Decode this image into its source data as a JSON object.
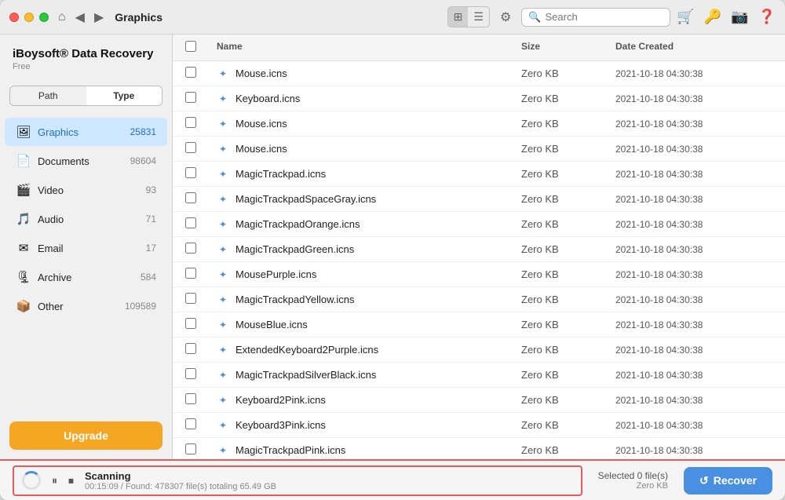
{
  "app": {
    "name": "iBoysoft® Data Recovery",
    "plan": "Free"
  },
  "titlebar": {
    "current_folder": "Graphics",
    "search_placeholder": "Search",
    "back_icon": "◀",
    "forward_icon": "▶",
    "home_icon": "⌂"
  },
  "sidebar": {
    "tabs": [
      "Path",
      "Type"
    ],
    "active_tab": "Type",
    "items": [
      {
        "id": "graphics",
        "label": "Graphics",
        "count": "25831",
        "icon": "🖼"
      },
      {
        "id": "documents",
        "label": "Documents",
        "count": "98604",
        "icon": "📄"
      },
      {
        "id": "video",
        "label": "Video",
        "count": "93",
        "icon": "🎬"
      },
      {
        "id": "audio",
        "label": "Audio",
        "count": "71",
        "icon": "🎵"
      },
      {
        "id": "email",
        "label": "Email",
        "count": "17",
        "icon": "✉"
      },
      {
        "id": "archive",
        "label": "Archive",
        "count": "584",
        "icon": "🗜"
      },
      {
        "id": "other",
        "label": "Other",
        "count": "109589",
        "icon": "📦"
      }
    ],
    "active_item": "graphics",
    "upgrade_label": "Upgrade"
  },
  "file_table": {
    "columns": [
      "",
      "Name",
      "Size",
      "Date Created"
    ],
    "files": [
      {
        "name": "Mouse.icns",
        "size": "Zero KB",
        "date": "2021-10-18 04:30:38"
      },
      {
        "name": "Keyboard.icns",
        "size": "Zero KB",
        "date": "2021-10-18 04:30:38"
      },
      {
        "name": "Mouse.icns",
        "size": "Zero KB",
        "date": "2021-10-18 04:30:38"
      },
      {
        "name": "Mouse.icns",
        "size": "Zero KB",
        "date": "2021-10-18 04:30:38"
      },
      {
        "name": "MagicTrackpad.icns",
        "size": "Zero KB",
        "date": "2021-10-18 04:30:38"
      },
      {
        "name": "MagicTrackpadSpaceGray.icns",
        "size": "Zero KB",
        "date": "2021-10-18 04:30:38"
      },
      {
        "name": "MagicTrackpadOrange.icns",
        "size": "Zero KB",
        "date": "2021-10-18 04:30:38"
      },
      {
        "name": "MagicTrackpadGreen.icns",
        "size": "Zero KB",
        "date": "2021-10-18 04:30:38"
      },
      {
        "name": "MousePurple.icns",
        "size": "Zero KB",
        "date": "2021-10-18 04:30:38"
      },
      {
        "name": "MagicTrackpadYellow.icns",
        "size": "Zero KB",
        "date": "2021-10-18 04:30:38"
      },
      {
        "name": "MouseBlue.icns",
        "size": "Zero KB",
        "date": "2021-10-18 04:30:38"
      },
      {
        "name": "ExtendedKeyboard2Purple.icns",
        "size": "Zero KB",
        "date": "2021-10-18 04:30:38"
      },
      {
        "name": "MagicTrackpadSilverBlack.icns",
        "size": "Zero KB",
        "date": "2021-10-18 04:30:38"
      },
      {
        "name": "Keyboard2Pink.icns",
        "size": "Zero KB",
        "date": "2021-10-18 04:30:38"
      },
      {
        "name": "Keyboard3Pink.icns",
        "size": "Zero KB",
        "date": "2021-10-18 04:30:38"
      },
      {
        "name": "MagicTrackpadPink.icns",
        "size": "Zero KB",
        "date": "2021-10-18 04:30:38"
      }
    ]
  },
  "status_bar": {
    "scan_title": "Scanning",
    "scan_detail": "00:15:09 / Found: 478307 file(s) totaling 65.49 GB",
    "selected_count": "Selected 0 file(s)",
    "selected_size": "Zero KB",
    "recover_label": "Recover"
  }
}
